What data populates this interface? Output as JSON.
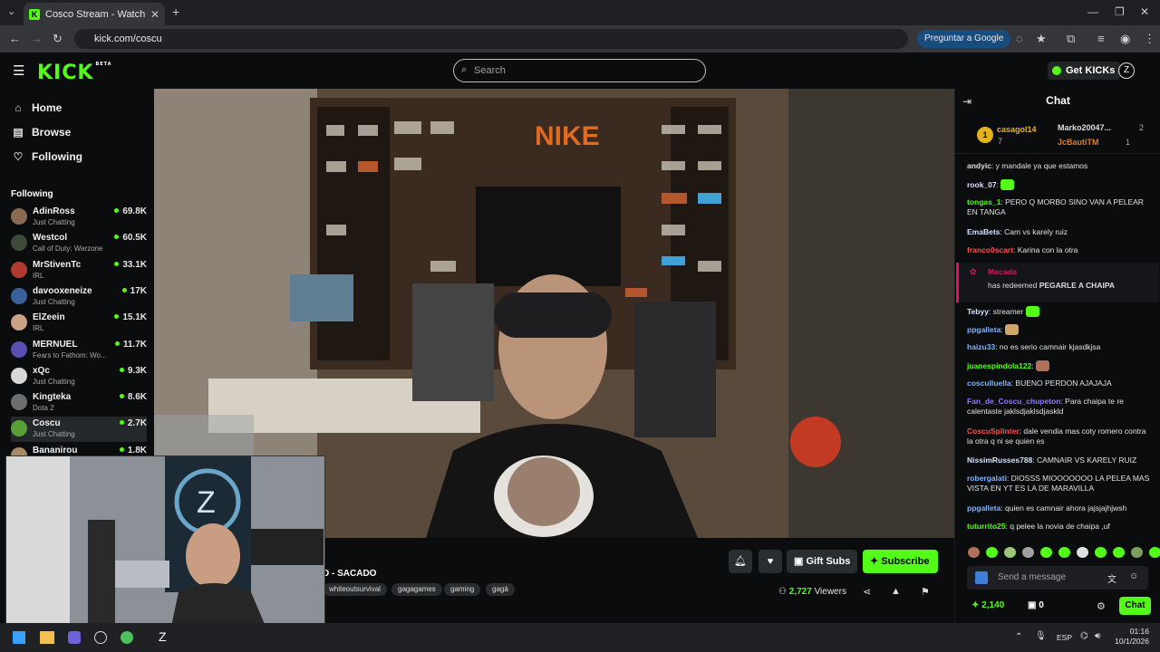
{
  "browser": {
    "tab_title": "Cosco Stream - Watch Live on K",
    "tab_icon": "K",
    "url": "kick.com/coscu",
    "google_btn": "Preguntar a Google"
  },
  "header": {
    "logo": "KICK",
    "logo_badge": "BETA",
    "search_placeholder": "Search",
    "get_kicks": "Get KICKs"
  },
  "sidebar": {
    "nav": [
      {
        "label": "Home",
        "icon": "home-icon"
      },
      {
        "label": "Browse",
        "icon": "browse-icon"
      },
      {
        "label": "Following",
        "icon": "heart-icon"
      }
    ],
    "following_heading": "Following",
    "channels": [
      {
        "name": "AdinRoss",
        "category": "Just Chatting",
        "viewers": "69.8K",
        "color": "#8a6b52"
      },
      {
        "name": "Westcol",
        "category": "Call of Duty: Warzone",
        "viewers": "60.5K",
        "color": "#3d4a3a"
      },
      {
        "name": "MrStivenTc",
        "category": "IRL",
        "viewers": "33.1K",
        "color": "#b03a2e"
      },
      {
        "name": "davooxeneize",
        "category": "Just Chatting",
        "viewers": "17K",
        "color": "#3b5f9a"
      },
      {
        "name": "ElZeein",
        "category": "IRL",
        "viewers": "15.1K",
        "color": "#c9a184"
      },
      {
        "name": "MERNUEL",
        "category": "Fears to Fathom: Wo...",
        "viewers": "11.7K",
        "color": "#5a4fb0"
      },
      {
        "name": "xQc",
        "category": "Just Chatting",
        "viewers": "9.3K",
        "color": "#d8d8d8"
      },
      {
        "name": "Kingteka",
        "category": "Dota 2",
        "viewers": "8.6K",
        "color": "#6e6e6e"
      },
      {
        "name": "Coscu",
        "category": "Just Chatting",
        "viewers": "2.7K",
        "color": "#58a035"
      },
      {
        "name": "Bananirou",
        "category": "",
        "viewers": "1.8K",
        "color": "#a78a63"
      }
    ]
  },
  "stream": {
    "title_fragment": "D - SACADO",
    "tags": [
      "whiteoutsurvival",
      "gagagames",
      "gaming",
      "gagá"
    ],
    "viewers_count": "2,727",
    "viewers_label": "Viewers",
    "gift_subs": "Gift Subs",
    "subscribe": "Subscribe"
  },
  "chat": {
    "title": "Chat",
    "leaderboard": [
      {
        "name": "casagol14",
        "rank": "1",
        "count": "7"
      },
      {
        "name": "Marko20047...",
        "count": "2"
      },
      {
        "name": "JcBautiTM",
        "count": "1"
      }
    ],
    "messages": [
      {
        "user": "andyic",
        "color": "#e0e0e0",
        "text": "y mandale ya que estamos"
      },
      {
        "user": "rook_07",
        "color": "#e9d7ff",
        "text": "",
        "emote": true
      },
      {
        "user": "tongas_1",
        "color": "#53fc18",
        "text": "PERO Q MORBO SINO VAN A PELEAR EN TANGA"
      },
      {
        "user": "EmaBets",
        "color": "#cfe3ff",
        "text": "Cam vs karely ruiz"
      },
      {
        "user": "franco0scart",
        "color": "#ff4d4d",
        "text": "Karina con la otra"
      },
      {
        "user": "Tebyy",
        "color": "#cfe3ff",
        "text": "streamer",
        "emote": true
      },
      {
        "user": "ppgalleta",
        "color": "#7fb2ff",
        "text": "",
        "emote": true
      },
      {
        "user": "haizu33",
        "color": "#7fb2ff",
        "text": "no es serio camnair kjasdkjsa"
      },
      {
        "user": "juanespindola122",
        "color": "#53fc18",
        "text": "",
        "emote": true
      },
      {
        "user": "cosculluella",
        "color": "#7fb2ff",
        "text": "BUENO PERDON AJAJAJA"
      },
      {
        "user": "Fan_de_Coscu_chupeton",
        "color": "#8f7bff",
        "text": "Para chaipa te re calentaste jaklsdjaklsdjaskld"
      },
      {
        "user": "CoscuSplinter",
        "color": "#ff4d4d",
        "text": "dale vendia mas coty romero contra la otra q ni se quien es"
      },
      {
        "user": "NissimRusses788",
        "color": "#cfe3ff",
        "text": "CAMNAIR VS KARELY RUIZ"
      },
      {
        "user": "robergalati",
        "color": "#7fb2ff",
        "text": "DIOSSS MIOOOOOOO LA PELEA MAS VISTA EN YT ES LA DE MARAVILLA"
      },
      {
        "user": "ppgalleta",
        "color": "#7fb2ff",
        "text": "quien es camnair ahora jajsjajhjwsh"
      },
      {
        "user": "tuturrito25",
        "color": "#53fc18",
        "text": "q pelee la novia de chaipa ,uf"
      }
    ],
    "redeem": {
      "user": "Mocado",
      "action": "has redeemed",
      "reward": "PEGARLE A CHAIPA"
    },
    "send_placeholder": "Send a message",
    "points": "2,140",
    "kicks": "0",
    "chat_button": "Chat"
  },
  "taskbar": {
    "lang": "ESP",
    "time": "01:16",
    "date": "10/1/2026"
  },
  "colors": {
    "accent": "#53fc18",
    "background": "#0b0c0d"
  }
}
